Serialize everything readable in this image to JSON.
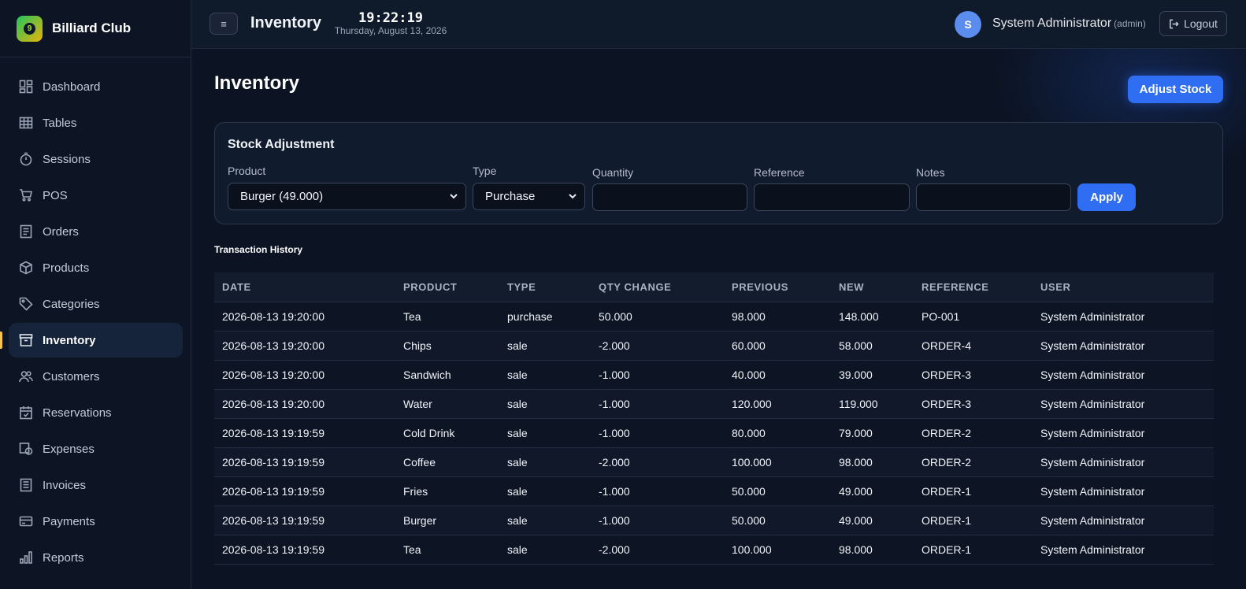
{
  "brand": {
    "name": "Billiard Club",
    "logo_glyph": "9"
  },
  "sidebar": {
    "items": [
      {
        "label": "Dashboard",
        "icon": "dashboard-icon"
      },
      {
        "label": "Tables",
        "icon": "table-grid-icon"
      },
      {
        "label": "Sessions",
        "icon": "stopwatch-icon"
      },
      {
        "label": "POS",
        "icon": "cart-icon"
      },
      {
        "label": "Orders",
        "icon": "receipt-icon"
      },
      {
        "label": "Products",
        "icon": "box-icon"
      },
      {
        "label": "Categories",
        "icon": "tag-icon"
      },
      {
        "label": "Inventory",
        "icon": "archive-icon",
        "active": true
      },
      {
        "label": "Customers",
        "icon": "users-icon"
      },
      {
        "label": "Reservations",
        "icon": "calendar-check-icon"
      },
      {
        "label": "Expenses",
        "icon": "expense-icon"
      },
      {
        "label": "Invoices",
        "icon": "invoice-icon"
      },
      {
        "label": "Payments",
        "icon": "credit-card-icon"
      },
      {
        "label": "Reports",
        "icon": "bar-chart-icon"
      }
    ]
  },
  "topbar": {
    "menu_glyph": "≡",
    "title": "Inventory",
    "time": "19:22:19",
    "date": "Thursday, August 13, 2026",
    "user_initial": "S",
    "user_name": "System Administrator",
    "user_role": "(admin)",
    "logout_label": "Logout"
  },
  "page": {
    "title": "Inventory",
    "adjust_button": "Adjust Stock"
  },
  "stock_adjustment": {
    "title": "Stock Adjustment",
    "product_label": "Product",
    "product_value": "Burger (49.000)",
    "type_label": "Type",
    "type_value": "Purchase",
    "quantity_label": "Quantity",
    "quantity_value": "",
    "reference_label": "Reference",
    "reference_value": "",
    "notes_label": "Notes",
    "notes_value": "",
    "apply_label": "Apply"
  },
  "history": {
    "title": "Transaction History",
    "columns": [
      "DATE",
      "PRODUCT",
      "TYPE",
      "QTY CHANGE",
      "PREVIOUS",
      "NEW",
      "REFERENCE",
      "USER"
    ],
    "rows": [
      [
        "2026-08-13 19:20:00",
        "Tea",
        "purchase",
        "50.000",
        "98.000",
        "148.000",
        "PO-001",
        "System Administrator"
      ],
      [
        "2026-08-13 19:20:00",
        "Chips",
        "sale",
        "-2.000",
        "60.000",
        "58.000",
        "ORDER-4",
        "System Administrator"
      ],
      [
        "2026-08-13 19:20:00",
        "Sandwich",
        "sale",
        "-1.000",
        "40.000",
        "39.000",
        "ORDER-3",
        "System Administrator"
      ],
      [
        "2026-08-13 19:20:00",
        "Water",
        "sale",
        "-1.000",
        "120.000",
        "119.000",
        "ORDER-3",
        "System Administrator"
      ],
      [
        "2026-08-13 19:19:59",
        "Cold Drink",
        "sale",
        "-1.000",
        "80.000",
        "79.000",
        "ORDER-2",
        "System Administrator"
      ],
      [
        "2026-08-13 19:19:59",
        "Coffee",
        "sale",
        "-2.000",
        "100.000",
        "98.000",
        "ORDER-2",
        "System Administrator"
      ],
      [
        "2026-08-13 19:19:59",
        "Fries",
        "sale",
        "-1.000",
        "50.000",
        "49.000",
        "ORDER-1",
        "System Administrator"
      ],
      [
        "2026-08-13 19:19:59",
        "Burger",
        "sale",
        "-1.000",
        "50.000",
        "49.000",
        "ORDER-1",
        "System Administrator"
      ],
      [
        "2026-08-13 19:19:59",
        "Tea",
        "sale",
        "-2.000",
        "100.000",
        "98.000",
        "ORDER-1",
        "System Administrator"
      ]
    ]
  },
  "colors": {
    "accent": "#2f6df2",
    "active_indicator": "#f5c451",
    "background": "#0c1322"
  }
}
